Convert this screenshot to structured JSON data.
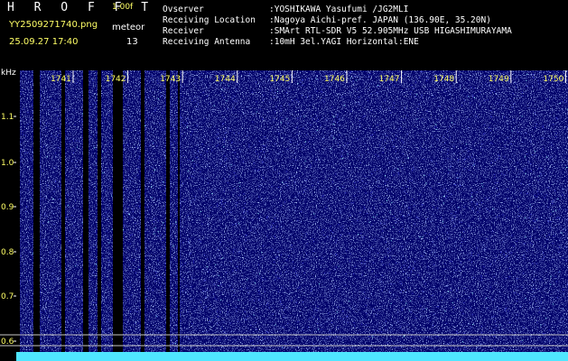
{
  "header": {
    "app_title": "H R O F F T",
    "version": "1.00f",
    "filename": "YY2509271740.png",
    "timestamp": "25.09.27 17:40",
    "meteor_label": "meteor",
    "meteor_count": "13",
    "info": [
      {
        "label": "Ovserver",
        "value": ":YOSHIKAWA Yasufumi /JG2MLI"
      },
      {
        "label": "Receiving Location",
        "value": ":Nagoya Aichi-pref. JAPAN (136.90E, 35.20N)"
      },
      {
        "label": "Receiver",
        "value": ":SMArt RTL-SDR V5 52.905MHz USB HIGASHIMURAYAMA"
      },
      {
        "label": "Receiving Antenna",
        "value": ":10mH 3el.YAGI Horizontal:ENE"
      }
    ]
  },
  "spectrogram": {
    "y_unit": "kHz",
    "y_ticks": [
      "1.1",
      "1.0",
      "0.9",
      "0.8",
      "0.7",
      "0.6"
    ],
    "time_labels": [
      "1741",
      "1742",
      "1743",
      "1744",
      "1745",
      "1746",
      "1747",
      "1748",
      "1749",
      "1750"
    ],
    "colors": {
      "background": "#00006a",
      "noise_primary": "#3f43d8",
      "noise_light": "#8ea8ff",
      "noise_cyan": "#8ff6ff",
      "gap": "#000000",
      "baseline": "#4fe6ff",
      "tick_label": "#ffff66"
    }
  }
}
